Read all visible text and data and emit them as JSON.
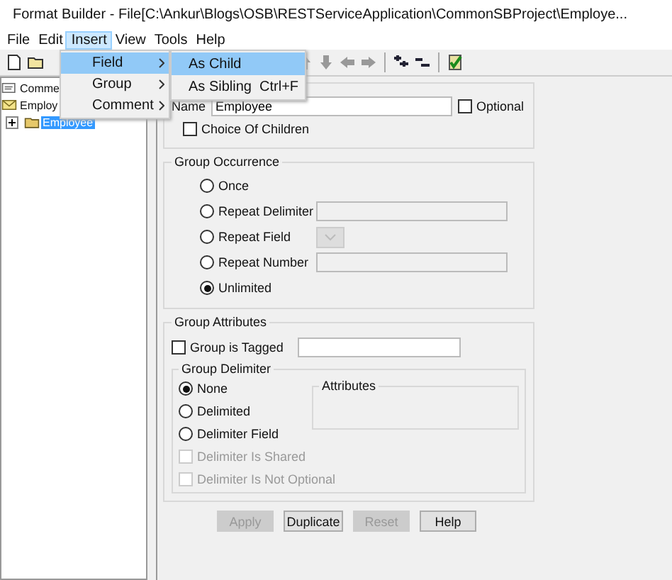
{
  "window": {
    "title": "Format Builder - File[C:\\Ankur\\Blogs\\OSB\\RESTServiceApplication\\CommonSBProject\\Employe..."
  },
  "menu_bar": [
    {
      "label": "File",
      "selected": false
    },
    {
      "label": "Edit",
      "selected": false
    },
    {
      "label": "Insert",
      "selected": true
    },
    {
      "label": "View",
      "selected": false
    },
    {
      "label": "Tools",
      "selected": false
    },
    {
      "label": "Help",
      "selected": false
    }
  ],
  "insert_menu": [
    {
      "label": "Field",
      "selected": true
    },
    {
      "label": "Group",
      "selected": false
    },
    {
      "label": "Comment",
      "selected": false
    }
  ],
  "field_submenu": [
    {
      "label": "As Child",
      "selected": true
    },
    {
      "label": "As Sibling",
      "shortcut": "Ctrl+F",
      "selected": false
    }
  ],
  "tree": [
    {
      "label": "Comme",
      "kind": "comment",
      "selected": false
    },
    {
      "label": "Employ",
      "kind": "message",
      "selected": false,
      "children": [
        {
          "label": "Employee",
          "kind": "group",
          "selected": true,
          "expanded": false
        }
      ]
    }
  ],
  "form": {
    "name_label": "Name",
    "name_value": "Employee",
    "optional": {
      "label": "Optional",
      "checked": false
    },
    "choice_of_children": {
      "label": "Choice Of Children",
      "checked": false
    },
    "group_occurrence": {
      "title": "Group Occurrence",
      "options": [
        {
          "label": "Once",
          "selected": false,
          "kind": "plain"
        },
        {
          "label": "Repeat Delimiter",
          "selected": false,
          "kind": "text"
        },
        {
          "label": "Repeat Field",
          "selected": false,
          "kind": "dropdown"
        },
        {
          "label": "Repeat Number",
          "selected": false,
          "kind": "text"
        },
        {
          "label": "Unlimited",
          "selected": true,
          "kind": "plain"
        }
      ]
    },
    "group_attributes": {
      "title": "Group Attributes",
      "tagged": {
        "label": "Group is Tagged",
        "checked": false
      },
      "group_delimiter": {
        "title": "Group Delimiter",
        "options": [
          {
            "label": "None",
            "selected": true
          },
          {
            "label": "Delimited",
            "selected": false
          },
          {
            "label": "Delimiter Field",
            "selected": false
          }
        ],
        "attributes_title": "Attributes",
        "checks": [
          {
            "label": "Delimiter Is Shared",
            "checked": false,
            "disabled": true
          },
          {
            "label": "Delimiter Is Not Optional",
            "checked": false,
            "disabled": true
          }
        ]
      }
    },
    "buttons": [
      {
        "label": "Apply",
        "disabled": true
      },
      {
        "label": "Duplicate",
        "disabled": false
      },
      {
        "label": "Reset",
        "disabled": true
      },
      {
        "label": "Help",
        "disabled": false
      }
    ]
  }
}
